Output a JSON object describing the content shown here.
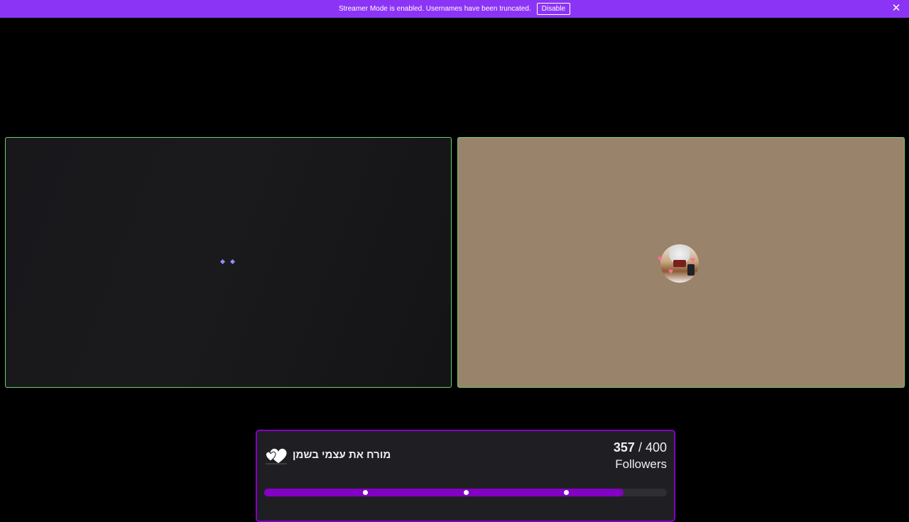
{
  "banner": {
    "message": "Streamer Mode is enabled. Usernames have been truncated.",
    "disable_label": "Disable",
    "close_icon": "close-icon"
  },
  "left_panel": {
    "state": "loading",
    "loader_icon": "loading-dots-icon"
  },
  "right_panel": {
    "avatar_icon": "streamer-avatar"
  },
  "goal": {
    "icon": "hearts-icon",
    "title": "מורח את עצמי בשמן",
    "current": "357",
    "separator": " / ",
    "target": "400",
    "label": "Followers",
    "progress_fraction": 0.8925,
    "milestones": [
      0.25,
      0.5,
      0.75
    ]
  },
  "colors": {
    "accent": "#8c34f5",
    "goal_purple": "#8400c4",
    "panel_border": "#6fcf6a"
  }
}
